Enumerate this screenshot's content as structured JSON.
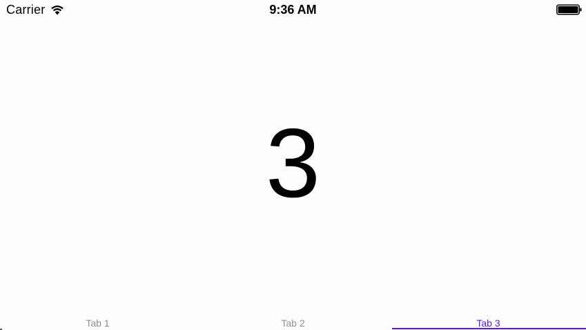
{
  "status_bar": {
    "carrier": "Carrier",
    "time": "9:36 AM",
    "wifi_icon": "wifi-icon",
    "battery_icon": "battery-icon"
  },
  "content": {
    "number": "3"
  },
  "tab_bar": {
    "active_index": 2,
    "accent_color": "#5a1ae6",
    "inactive_color": "#8e8e93",
    "tabs": [
      {
        "label": "Tab 1"
      },
      {
        "label": "Tab 2"
      },
      {
        "label": "Tab 3"
      }
    ]
  }
}
